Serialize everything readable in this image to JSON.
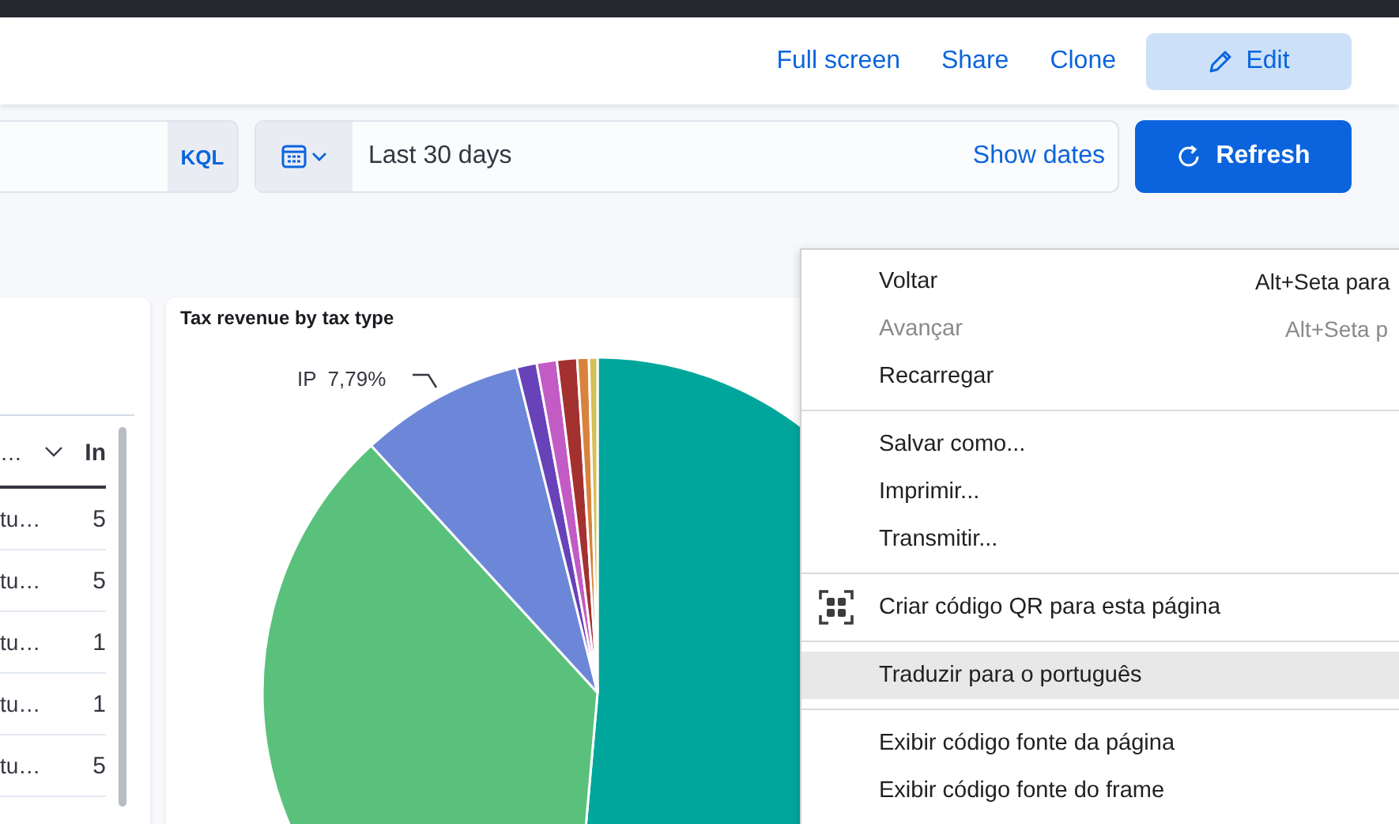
{
  "header": {
    "links": [
      "Full screen",
      "Share",
      "Clone"
    ],
    "edit_button": "Edit"
  },
  "query_bar": {
    "language": "KQL",
    "date_range": "Last 30 days",
    "show_dates": "Show dates",
    "refresh_button": "Refresh"
  },
  "table": {
    "columns": [
      "…",
      "In"
    ],
    "rows": [
      [
        "tu…",
        "5"
      ],
      [
        "tu…",
        "5"
      ],
      [
        "tu…",
        "1"
      ],
      [
        "tu…",
        "1"
      ],
      [
        "tu…",
        "5"
      ]
    ]
  },
  "chart_panel": {
    "title": "Tax revenue by tax type",
    "slice_label": "IP  7,79%"
  },
  "context_menu": [
    {
      "kind": "item",
      "label": "Voltar",
      "shortcut": "Alt+Seta para",
      "disabled": false,
      "selected": false
    },
    {
      "kind": "item",
      "label": "Avançar",
      "shortcut": "Alt+Seta p",
      "disabled": true,
      "selected": false
    },
    {
      "kind": "item",
      "label": "Recarregar",
      "disabled": false,
      "selected": false
    },
    {
      "kind": "separator"
    },
    {
      "kind": "item",
      "label": "Salvar como...",
      "disabled": false,
      "selected": false
    },
    {
      "kind": "item",
      "label": "Imprimir...",
      "disabled": false,
      "selected": false
    },
    {
      "kind": "item",
      "label": "Transmitir...",
      "disabled": false,
      "selected": false
    },
    {
      "kind": "separator"
    },
    {
      "kind": "icon_item",
      "label": "Criar código QR para esta página",
      "disabled": false,
      "selected": false
    },
    {
      "kind": "separator"
    },
    {
      "kind": "item",
      "label": "Traduzir para o português",
      "disabled": false,
      "selected": true
    },
    {
      "kind": "separator"
    },
    {
      "kind": "item",
      "label": "Exibir código fonte da página",
      "disabled": false,
      "selected": false
    },
    {
      "kind": "item",
      "label": "Exibir código fonte do frame",
      "disabled": false,
      "selected": false
    }
  ]
}
